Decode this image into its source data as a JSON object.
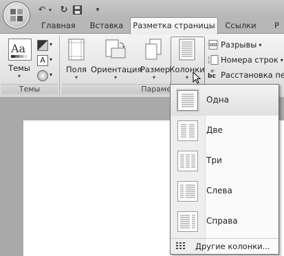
{
  "tabs": [
    {
      "label": "Главная"
    },
    {
      "label": "Вставка"
    },
    {
      "label": "Разметка страницы",
      "active": true
    },
    {
      "label": "Ссылки"
    },
    {
      "label": "Р"
    }
  ],
  "ribbon": {
    "themes_group": {
      "themes_label": "Темы",
      "group_label": "Темы",
      "icon_text": "Aa"
    },
    "page_setup": {
      "margins_label": "Поля",
      "orientation_label": "Ориентация",
      "size_label": "Размер",
      "columns_label": "Колонки",
      "group_label": "Параме"
    },
    "small_buttons": {
      "breaks": "Разрывы",
      "line_numbers": "Номера строк",
      "hyphenation": "Расстановка пере",
      "hyphenation_icon_text": "bc",
      "hyphenation_icon_sup": "a-"
    }
  },
  "columns_menu": {
    "items": [
      {
        "label": "Одна",
        "cols": 1,
        "selected": true
      },
      {
        "label": "Две",
        "cols": 2
      },
      {
        "label": "Три",
        "cols": 3
      },
      {
        "label": "Слева",
        "cols": "left"
      },
      {
        "label": "Справа",
        "cols": "right"
      }
    ],
    "more_label": "Другие колонки..."
  }
}
